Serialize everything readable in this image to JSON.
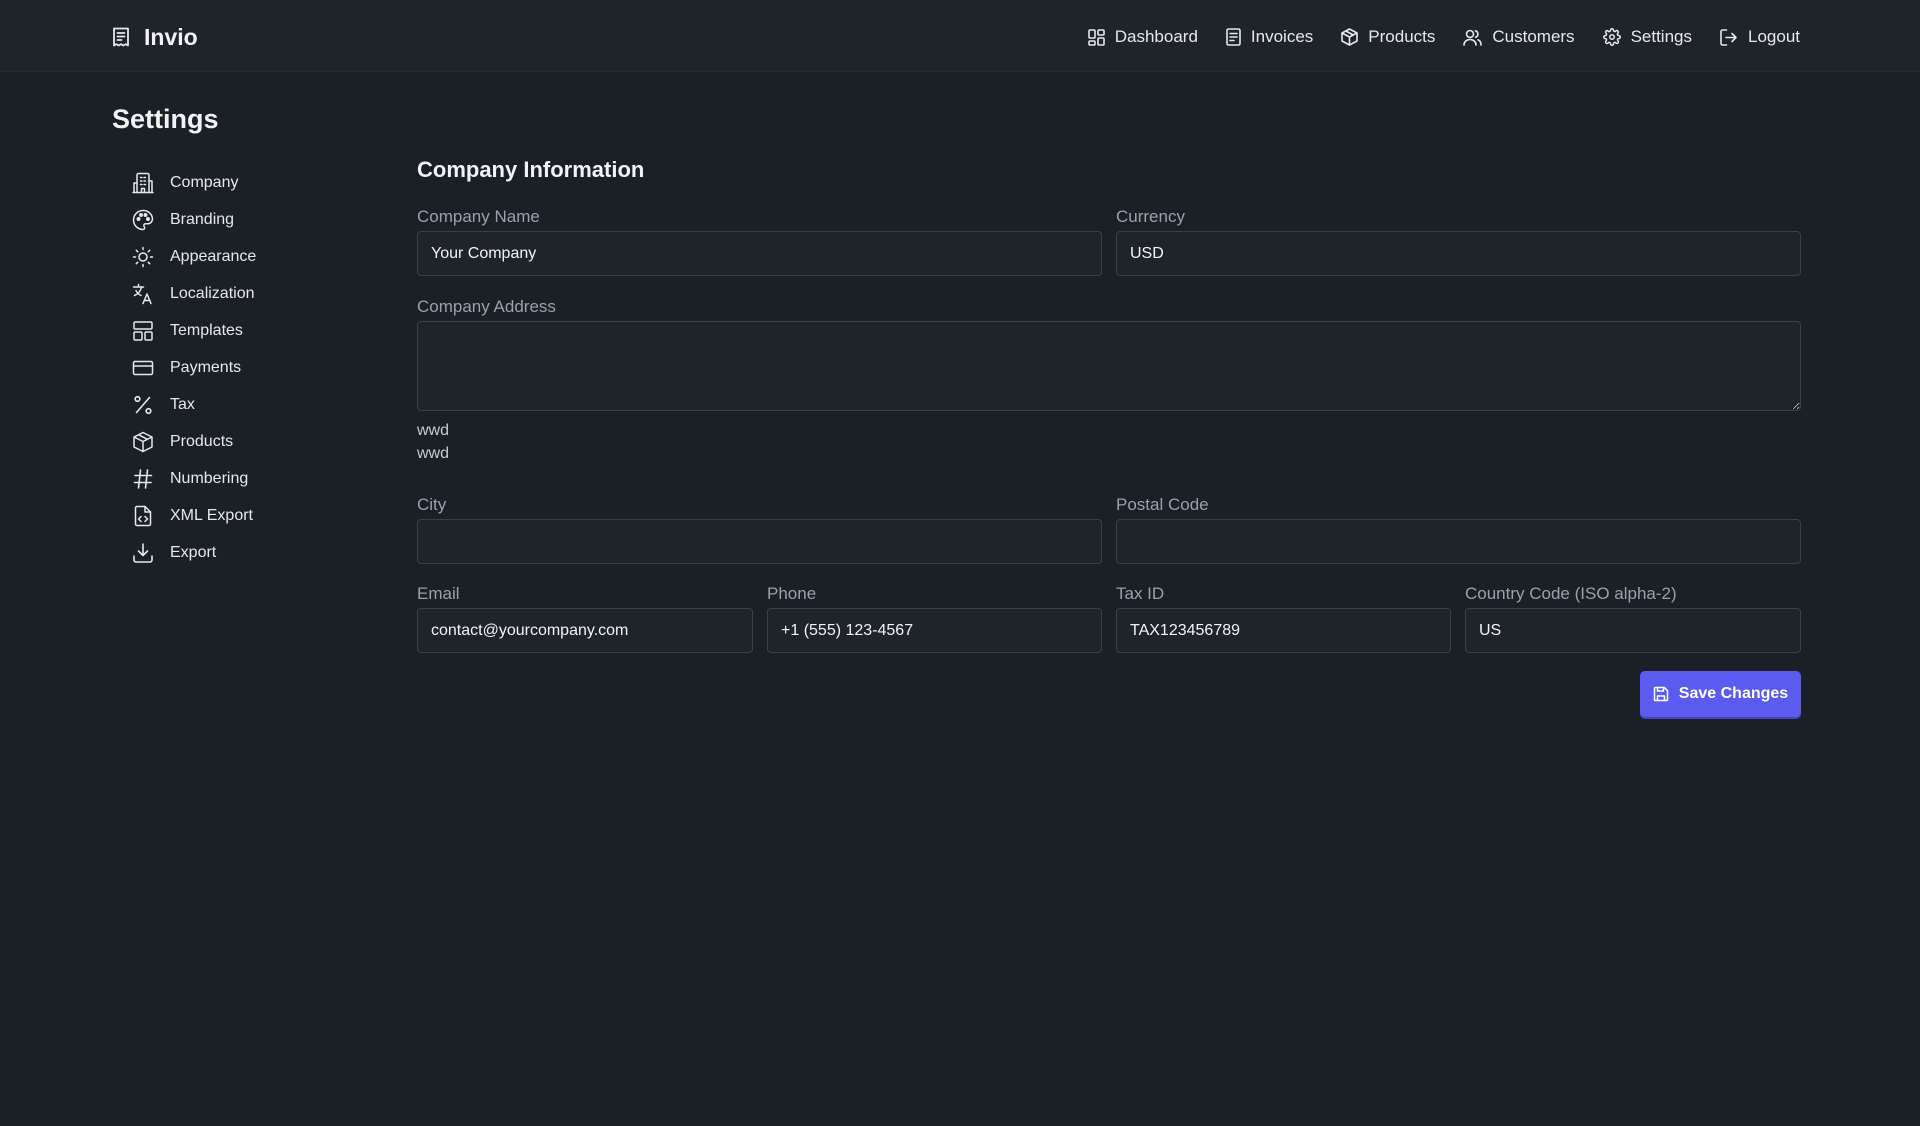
{
  "app": {
    "name": "Invio",
    "logo_icon": "receipt-icon"
  },
  "nav": [
    {
      "label": "Dashboard",
      "icon": "grid-icon"
    },
    {
      "label": "Invoices",
      "icon": "document-icon"
    },
    {
      "label": "Products",
      "icon": "box-icon"
    },
    {
      "label": "Customers",
      "icon": "users-icon"
    },
    {
      "label": "Settings",
      "icon": "gear-icon"
    },
    {
      "label": "Logout",
      "icon": "logout-icon"
    }
  ],
  "page": {
    "title": "Settings"
  },
  "sidebar": {
    "items": [
      {
        "label": "Company",
        "icon": "building-icon"
      },
      {
        "label": "Branding",
        "icon": "palette-icon"
      },
      {
        "label": "Appearance",
        "icon": "sun-icon"
      },
      {
        "label": "Localization",
        "icon": "translate-icon"
      },
      {
        "label": "Templates",
        "icon": "layout-icon"
      },
      {
        "label": "Payments",
        "icon": "credit-card-icon"
      },
      {
        "label": "Tax",
        "icon": "percent-icon"
      },
      {
        "label": "Products",
        "icon": "box-icon"
      },
      {
        "label": "Numbering",
        "icon": "hash-icon"
      },
      {
        "label": "XML Export",
        "icon": "file-code-icon"
      },
      {
        "label": "Export",
        "icon": "download-icon"
      }
    ]
  },
  "form": {
    "section_title": "Company Information",
    "company_name": {
      "label": "Company Name",
      "value": "Your Company"
    },
    "currency": {
      "label": "Currency",
      "value": "USD"
    },
    "company_address": {
      "label": "Company Address",
      "value": ""
    },
    "address_preview": [
      "wwd",
      "wwd"
    ],
    "city": {
      "label": "City",
      "value": ""
    },
    "postal_code": {
      "label": "Postal Code",
      "value": ""
    },
    "email": {
      "label": "Email",
      "value": "contact@yourcompany.com"
    },
    "phone": {
      "label": "Phone",
      "value": "+1 (555) 123-4567"
    },
    "tax_id": {
      "label": "Tax ID",
      "value": "TAX123456789"
    },
    "country_code": {
      "label": "Country Code (ISO alpha-2)",
      "value": "US"
    },
    "save_label": "Save Changes",
    "save_icon": "save-icon"
  },
  "colors": {
    "background": "#1b1f26",
    "topbar": "#1f242b",
    "accent": "#5b5bf0",
    "label": "#9aa1ab",
    "input_border": "#3a4049"
  }
}
